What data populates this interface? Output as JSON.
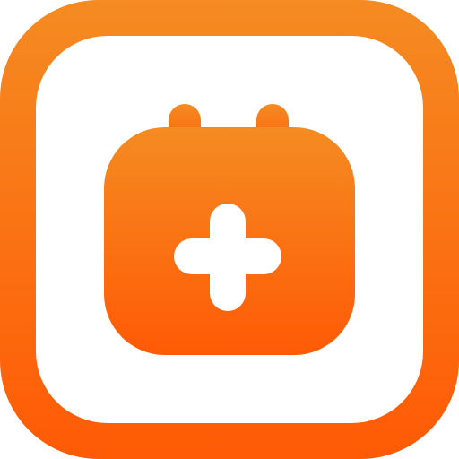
{
  "app_icon": {
    "icon_name": "calendar-plus-icon",
    "colors": {
      "gradient_top": "#F58B22",
      "gradient_bottom": "#FF5A05",
      "inner_background": "#FFFFFF",
      "plus_sign": "#FFFFFF"
    }
  }
}
